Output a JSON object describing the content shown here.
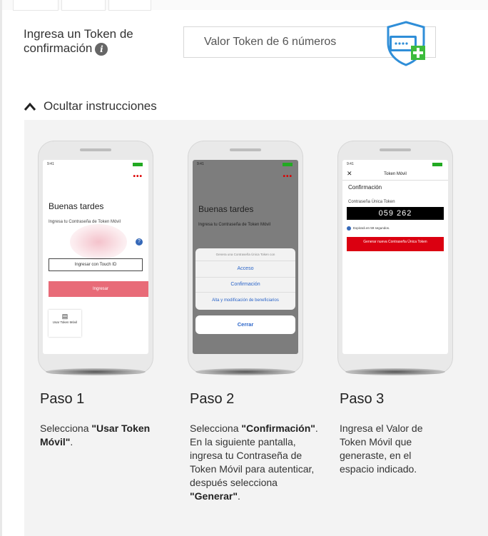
{
  "token": {
    "label": "Ingresa un Token de confirmación",
    "info_glyph": "i",
    "input_placeholder": "Valor Token de 6 números"
  },
  "toggle": {
    "label": "Ocultar instrucciones"
  },
  "phones": {
    "p1": {
      "greeting": "Buenas tardes",
      "prompt": "Ingresa tu Contraseña de Token Móvil",
      "touch_id": "Ingresar con Touch ID",
      "login": "Ingresar",
      "use_token": "Usar Token Móvil",
      "dots": "•••"
    },
    "p2": {
      "greeting": "Buenas tardes",
      "prompt": "Ingresa tu Contraseña de Token Móvil",
      "sheet_title": "Genera una Contraseña Única Token con",
      "opt1": "Acceso",
      "opt2": "Confirmación",
      "opt3": "Alta y modificación de beneficiarios",
      "close": "Cerrar",
      "dots": "•••"
    },
    "p3": {
      "header": "Token Móvil",
      "close_glyph": "✕",
      "section": "Confirmación",
      "field": "Contraseña Única Token",
      "code": "059 262",
      "expires": "Expirará en 59 segundos.",
      "generate": "Generar nueva Contraseña Única Token"
    }
  },
  "steps": [
    {
      "title": "Paso 1",
      "pre1": "Selecciona ",
      "b1": "\"Usar Token Móvil\"",
      "post1": "."
    },
    {
      "title": "Paso 2",
      "pre1": "Selecciona ",
      "b1": "\"Confirmación\"",
      "post1": ". En la siguiente pantalla, ingresa tu Contraseña de Token Móvil para autenticar, después selecciona ",
      "b2": "\"Generar\"",
      "post2": "."
    },
    {
      "title": "Paso 3",
      "text": "Ingresa el Valor de Token Móvil que generaste, en el espacio indicado."
    }
  ],
  "colors": {
    "accent_red": "#db0011",
    "shield_blue": "#2f8ed8",
    "shield_green": "#3dbb3d"
  }
}
